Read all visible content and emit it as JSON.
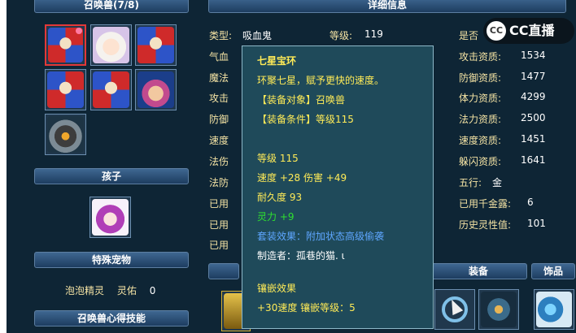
{
  "left": {
    "summon_title": "召唤兽(7/8)",
    "child_title": "孩子",
    "pet_title": "特殊宠物",
    "pet_name": "泡泡精灵",
    "pet_skill": "灵佑",
    "pet_skill_value": "0",
    "heart_skill_title": "召唤兽心得技能"
  },
  "detail": {
    "title": "详细信息",
    "type_label": "类型:",
    "type_value": "吸血鬼",
    "level_label": "等级:",
    "level_value": "119",
    "left_labels": [
      "气血",
      "魔法",
      "攻击",
      "防御",
      "速度",
      "法伤",
      "法防",
      "已用",
      "已用",
      "已用"
    ],
    "right_top_label": "是否",
    "right_stats": [
      {
        "label": "攻击资质:",
        "value": "1534"
      },
      {
        "label": "防御资质:",
        "value": "1477"
      },
      {
        "label": "体力资质:",
        "value": "4299"
      },
      {
        "label": "法力资质:",
        "value": "2500"
      },
      {
        "label": "速度资质:",
        "value": "1451"
      },
      {
        "label": "躲闪资质:",
        "value": "1641"
      },
      {
        "label": "五行:",
        "value": "金"
      },
      {
        "label": "已用千金露:",
        "value": "6"
      },
      {
        "label": "历史灵性值:",
        "value": "101"
      }
    ],
    "equip_title": "装备",
    "ornament_title": "饰品"
  },
  "tooltip": {
    "name": "七星宝环",
    "desc": "环聚七星，赋予更快的速度。",
    "target": "【装备对象】召唤兽",
    "condition": "【装备条件】等级115",
    "level": "等级 115",
    "stats": "速度 +28 伤害 +49",
    "durability": "耐久度 93",
    "spirit": "灵力 +9",
    "set_effect": "套装效果：附加状态高级偷袭",
    "maker": "制造者：孤巷的猫. ι",
    "inlay_title": "镶嵌效果",
    "inlay": "+30速度 镶嵌等级：5"
  },
  "logo": {
    "mark": "CC",
    "text": "CC直播"
  }
}
